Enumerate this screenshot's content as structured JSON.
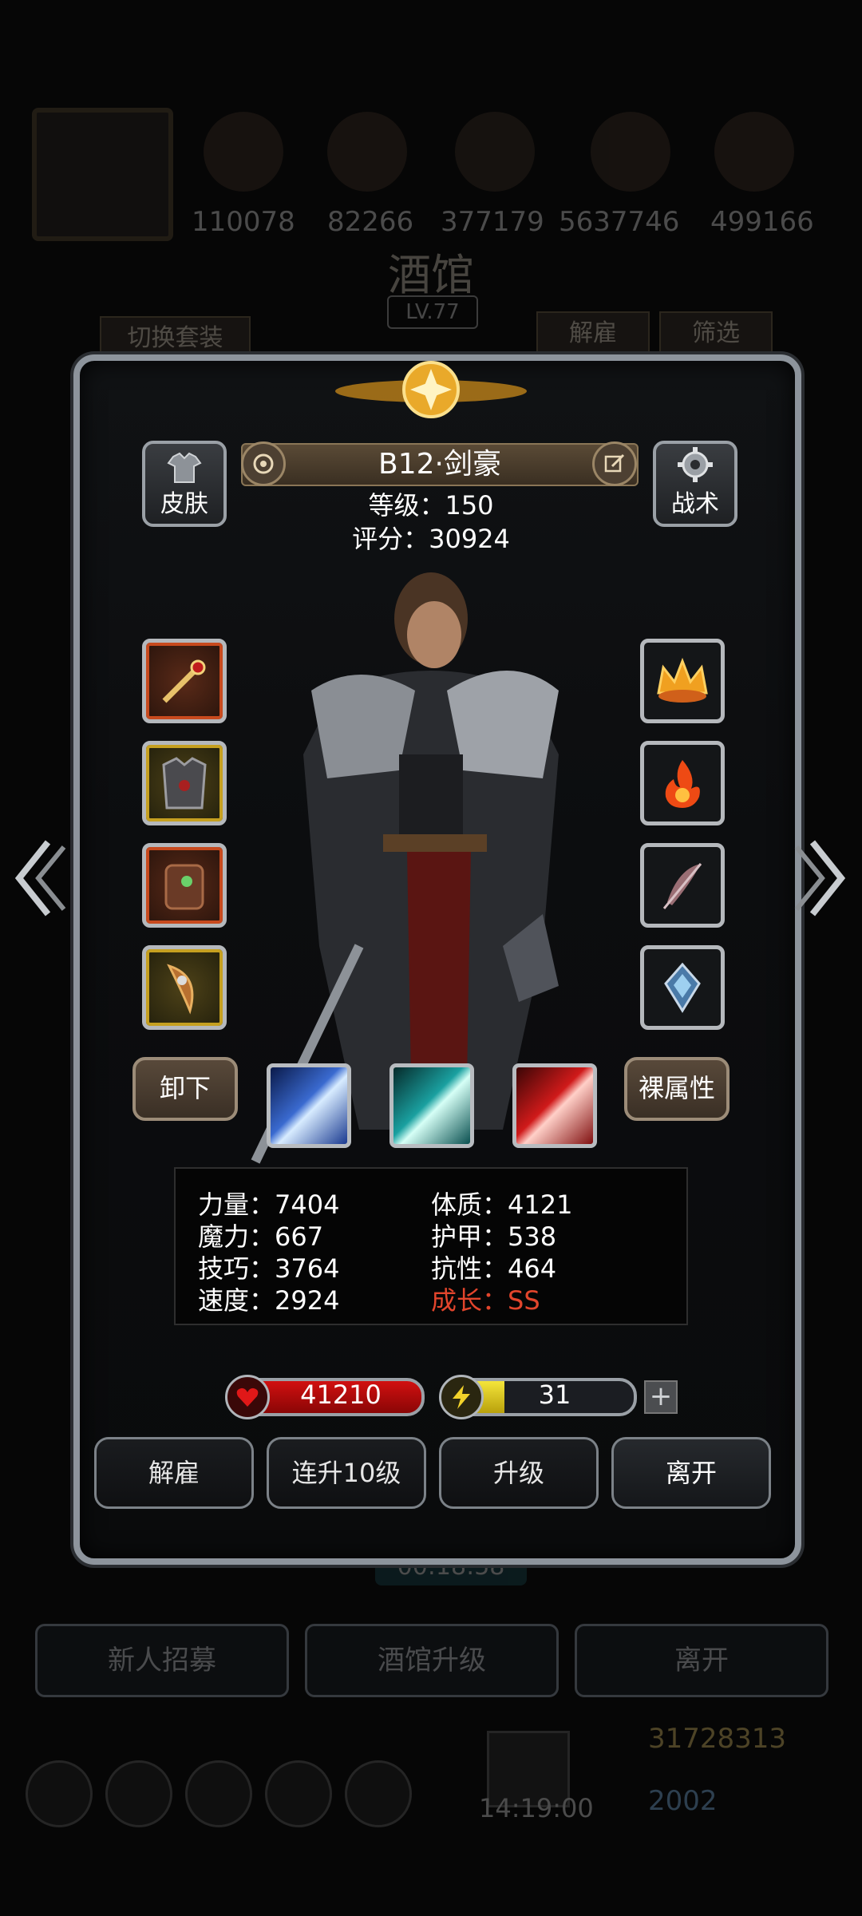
{
  "background": {
    "resources": [
      "110078",
      "82266",
      "377179",
      "5637746",
      "499166"
    ],
    "title": "酒馆",
    "level": "LV.77",
    "switch_outfit": "切换套装",
    "dismiss": "解雇",
    "filter": "筛选",
    "timer": "00:18:58",
    "tabs": [
      "新人招募",
      "酒馆升级",
      "离开"
    ],
    "gold": "31728313",
    "gems": "2002",
    "clock": "14:19:00"
  },
  "hero": {
    "name": "B12·剑豪",
    "level_label": "等级：150",
    "score_label": "评分：30924",
    "skin_button": "皮肤",
    "tactics_button": "战术",
    "unequip_button": "卸下",
    "naked_attr_button": "裸属性"
  },
  "stats": {
    "strength": "力量：7404",
    "constitution": "体质：4121",
    "magic": "魔力：667",
    "armor": "护甲：538",
    "skill": "技巧：3764",
    "resistance": "抗性：464",
    "speed": "速度：2924",
    "growth": "成长：SS"
  },
  "bars": {
    "hp_value": "41210",
    "energy_value": "31",
    "energy_fill": 0.3
  },
  "actions": {
    "dismiss": "解雇",
    "level_up_10": "连升10级",
    "level_up": "升级",
    "leave": "离开"
  },
  "equipment": {
    "left": [
      "weapon-sword-icon",
      "chest-armor-icon",
      "backpack-armor-icon",
      "horn-trinket-icon"
    ],
    "right": [
      "fire-crown-icon",
      "fire-orb-icon",
      "feather-icon",
      "crystal-emblem-icon"
    ]
  },
  "skills": [
    "blue-slash-icon",
    "cyan-slash-icon",
    "red-slash-icon"
  ],
  "colors": {
    "growth_red": "#e2452c",
    "hp_red": "#d11010",
    "energy_yellow": "#f4e53a",
    "frame_silver": "#8d949c"
  }
}
